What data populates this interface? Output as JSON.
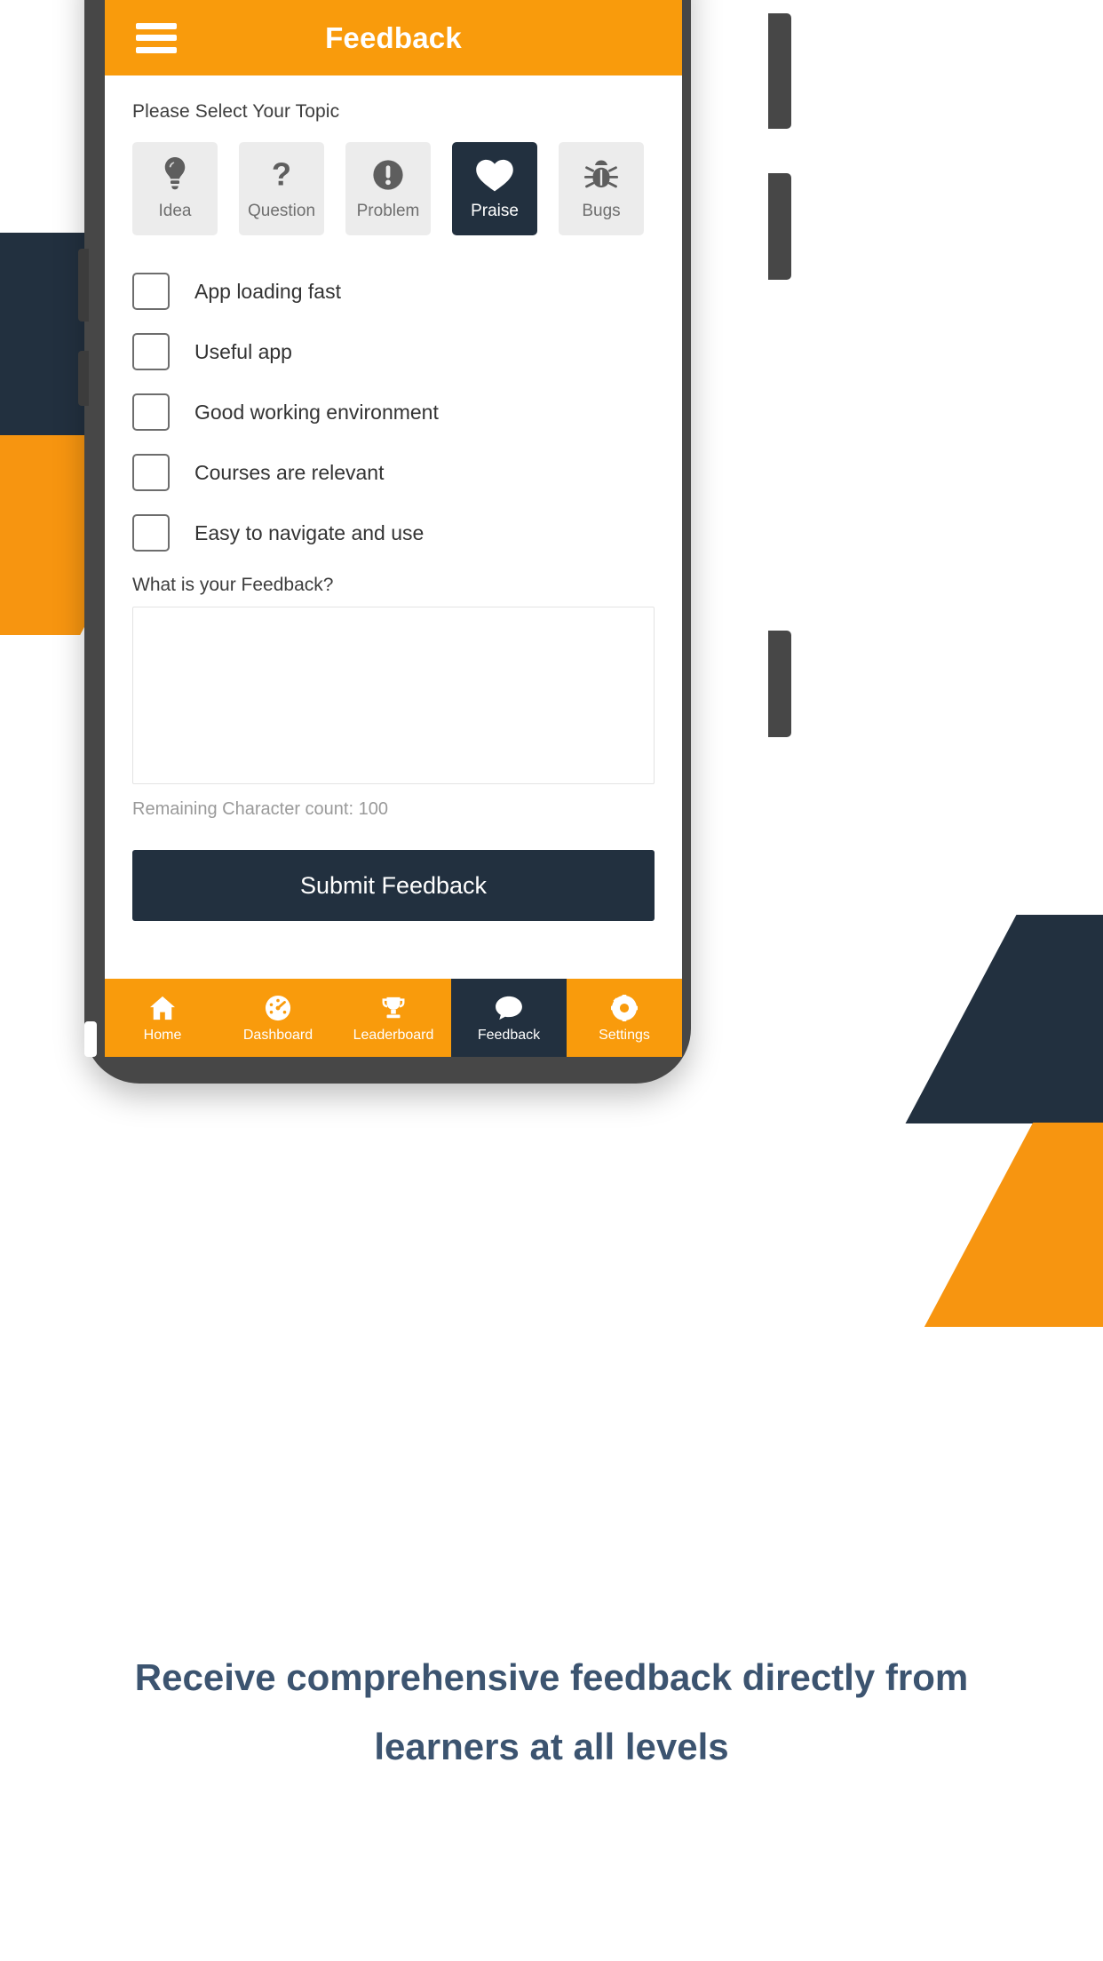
{
  "appbar": {
    "menu_icon": "hamburger-menu-icon",
    "title": "Feedback"
  },
  "form": {
    "topic_label": "Please Select Your Topic",
    "topics": [
      {
        "label": "Idea",
        "icon": "lightbulb-icon",
        "selected": false
      },
      {
        "label": "Question",
        "icon": "question-mark-icon",
        "selected": false
      },
      {
        "label": "Problem",
        "icon": "exclamation-circle-icon",
        "selected": false
      },
      {
        "label": "Praise",
        "icon": "heart-icon",
        "selected": true
      },
      {
        "label": "Bugs",
        "icon": "bug-icon",
        "selected": false
      }
    ],
    "checkboxes": [
      {
        "label": "App loading fast",
        "checked": false
      },
      {
        "label": "Useful app",
        "checked": false
      },
      {
        "label": "Good working environment",
        "checked": false
      },
      {
        "label": "Courses are relevant",
        "checked": false
      },
      {
        "label": "Easy to navigate and use",
        "checked": false
      }
    ],
    "feedback_label": "What is your Feedback?",
    "feedback_value": "",
    "feedback_placeholder": "",
    "char_count": "Remaining Character count: 100",
    "submit_label": "Submit Feedback"
  },
  "bottomnav": [
    {
      "label": "Home",
      "icon": "home-icon",
      "active": false
    },
    {
      "label": "Dashboard",
      "icon": "gauge-icon",
      "active": false
    },
    {
      "label": "Leaderboard",
      "icon": "trophy-icon",
      "active": false
    },
    {
      "label": "Feedback",
      "icon": "chat-bubble-icon",
      "active": true
    },
    {
      "label": "Settings",
      "icon": "gear-icon",
      "active": false
    }
  ],
  "caption": "Receive comprehensive feedback directly from learners at all levels",
  "colors": {
    "brand_orange": "#f99b0c",
    "brand_navy": "#22303f",
    "caption_navy": "#3c5470",
    "chip_grey": "#ececec"
  }
}
